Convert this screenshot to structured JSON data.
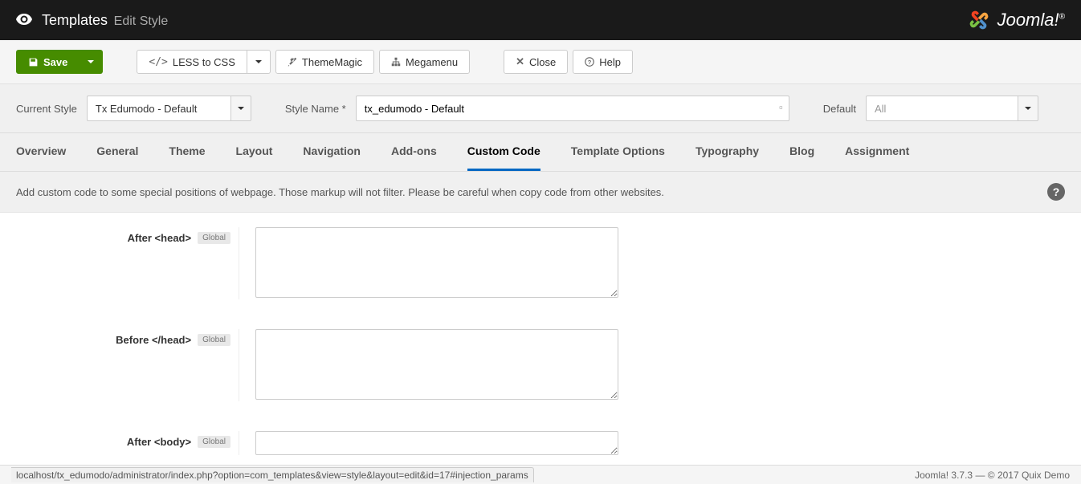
{
  "header": {
    "title": "Templates",
    "subtitle": "Edit Style",
    "brand": "Joomla!"
  },
  "toolbar": {
    "save": "Save",
    "less": "LESS to CSS",
    "theme": "ThemeMagic",
    "mega": "Megamenu",
    "close": "Close",
    "help": "Help"
  },
  "filters": {
    "current_style_label": "Current Style",
    "current_style_value": "Tx Edumodo - Default",
    "style_name_label": "Style Name *",
    "style_name_value": "tx_edumodo - Default",
    "default_label": "Default",
    "default_value": "All"
  },
  "tabs": [
    "Overview",
    "General",
    "Theme",
    "Layout",
    "Navigation",
    "Add-ons",
    "Custom Code",
    "Template Options",
    "Typography",
    "Blog",
    "Assignment"
  ],
  "active_tab_index": 6,
  "description": "Add custom code to some special positions of webpage. Those markup will not filter. Please be careful when copy code from other websites.",
  "fields": [
    {
      "label": "After <head>",
      "badge": "Global",
      "value": ""
    },
    {
      "label": "Before </head>",
      "badge": "Global",
      "value": ""
    },
    {
      "label": "After <body>",
      "badge": "Global",
      "value": ""
    }
  ],
  "footer": {
    "url": "localhost/tx_edumodo/administrator/index.php?option=com_templates&view=style&layout=edit&id=17#injection_params",
    "right": "Joomla! 3.7.3  —  © 2017 Quix Demo"
  }
}
